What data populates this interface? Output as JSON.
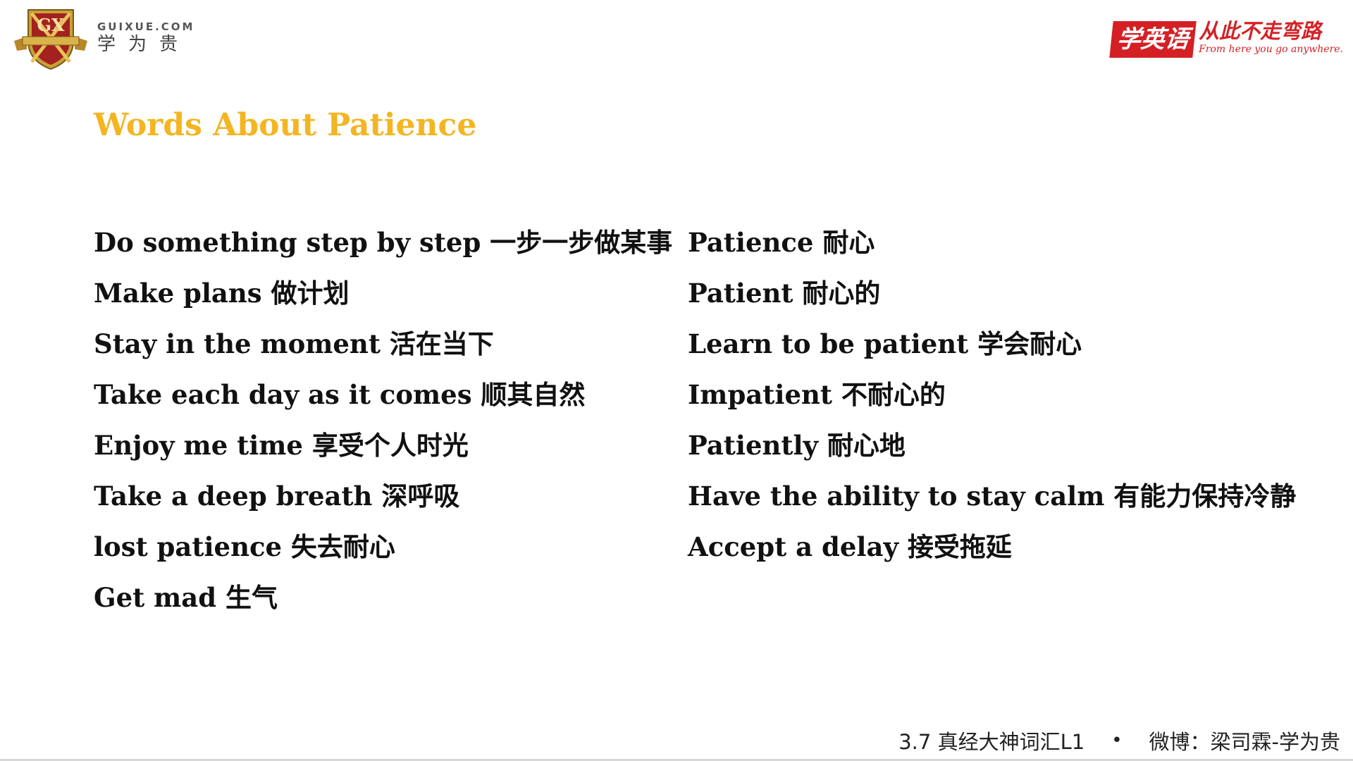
{
  "header": {
    "brand_domain": "GUIXUE.COM",
    "brand_cn": "学为贵",
    "red_box_text": "学英语",
    "slogan_cn": "从此不走弯路",
    "slogan_en": "From here you go anywhere.",
    "crest_letters": "GX",
    "accent_color": "#d42025"
  },
  "slide": {
    "title": "Words About Patience",
    "title_color": "#f3b521",
    "left_phrases": [
      "Do something step by step 一步一步做某事",
      "Make plans 做计划",
      "Stay in the moment 活在当下",
      "Take each day as it comes 顺其自然",
      "Enjoy me time 享受个人时光",
      "Take a deep breath 深呼吸",
      "lost patience 失去耐心",
      "Get mad 生气"
    ],
    "right_phrases": [
      "Patience 耐心",
      "Patient 耐心的",
      "Learn to be patient 学会耐心",
      "Impatient 不耐心的",
      "Patiently 耐心地",
      "Have the ability to stay calm 有能力保持冷静",
      "Accept a delay 接受拖延"
    ]
  },
  "footer": {
    "course": "3.7 真经大神词汇L1",
    "separator": "•",
    "weibo": "微博：梁司霖-学为贵"
  }
}
